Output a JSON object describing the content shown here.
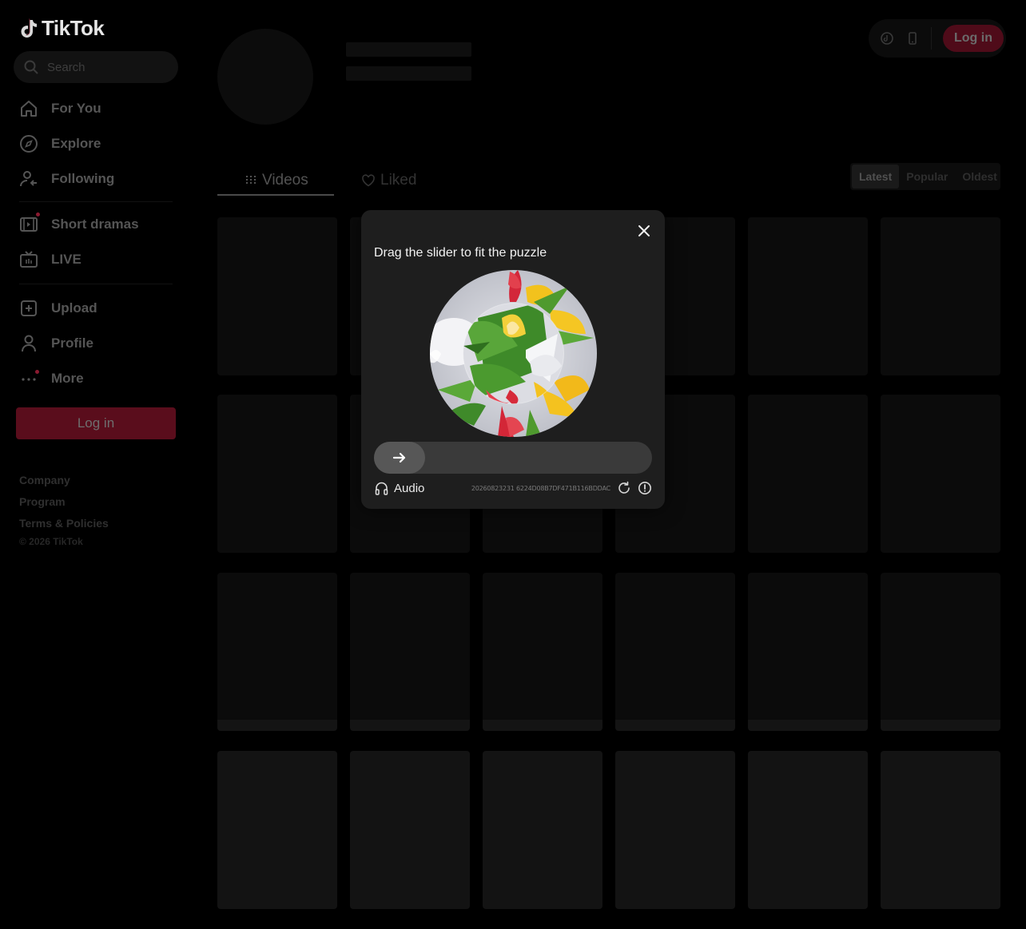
{
  "app": {
    "logo_text": "TikTok"
  },
  "search": {
    "placeholder": "Search"
  },
  "sidebar": {
    "nav": [
      {
        "label": "For You",
        "icon": "home-icon"
      },
      {
        "label": "Explore",
        "icon": "compass-icon"
      },
      {
        "label": "Following",
        "icon": "following-icon"
      },
      {
        "label": "Short dramas",
        "icon": "film-icon"
      },
      {
        "label": "LIVE",
        "icon": "live-tv-icon"
      },
      {
        "label": "Upload",
        "icon": "upload-plus-icon"
      },
      {
        "label": "Profile",
        "icon": "person-icon"
      },
      {
        "label": "More",
        "icon": "more-dots-icon"
      }
    ],
    "login_label": "Log in",
    "footer": [
      "Company",
      "Program",
      "Terms & Policies"
    ],
    "copyright": "© 2026 TikTok"
  },
  "header": {
    "login_label": "Log in"
  },
  "tabs": {
    "videos": "Videos",
    "liked": "Liked"
  },
  "sort": {
    "options": [
      "Latest",
      "Popular",
      "Oldest"
    ],
    "selected": "Latest"
  },
  "captcha": {
    "title": "Drag the slider to fit the puzzle",
    "audio_label": "Audio",
    "id": "20260823231 6224D08B7DF471B116BDDAC",
    "slider_progress": 0
  },
  "colors": {
    "brand_red": "#fe2c55",
    "background": "#000000",
    "modal": "#1e1e1e"
  }
}
